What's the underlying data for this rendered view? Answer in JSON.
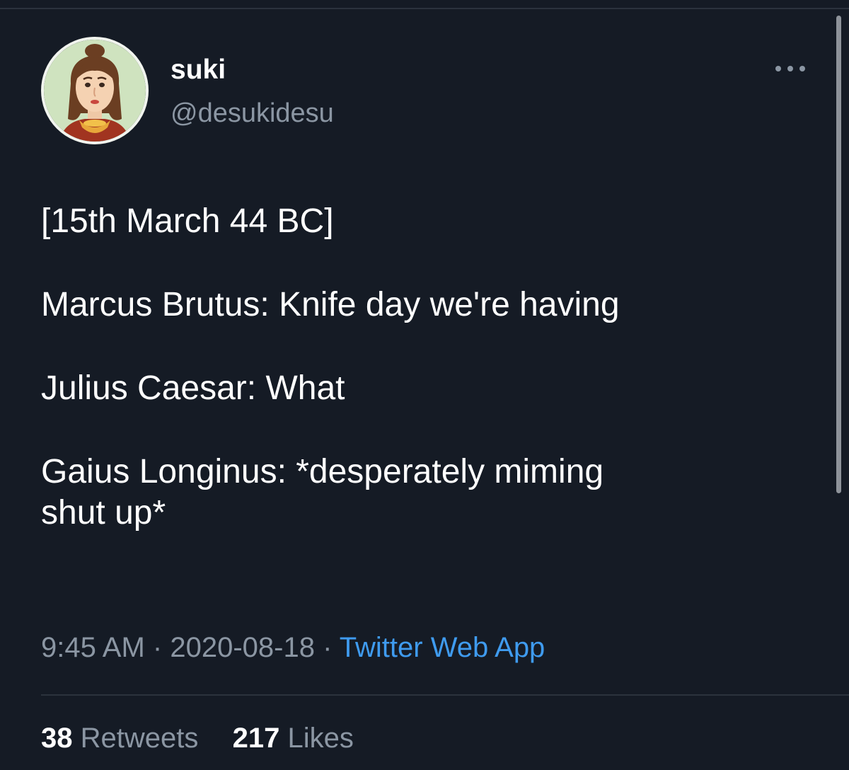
{
  "author": {
    "display_name": "suki",
    "handle": "@desukidesu",
    "avatar_icon": "cartoon-portrait-avatar"
  },
  "tweet": {
    "lines": [
      "[15th March 44 BC]",
      "Marcus Brutus: Knife day we're having",
      "Julius Caesar: What",
      "Gaius Longinus: *desperately miming",
      "shut up*"
    ]
  },
  "meta": {
    "time": "9:45 AM",
    "separator": "·",
    "date": "2020-08-18",
    "source": "Twitter Web App"
  },
  "stats": {
    "retweets_count": "38",
    "retweets_label": "Retweets",
    "likes_count": "217",
    "likes_label": "Likes"
  },
  "colors": {
    "background": "#151b25",
    "text_primary": "#ffffff",
    "text_secondary": "#8b96a3",
    "link": "#3f9bef"
  }
}
